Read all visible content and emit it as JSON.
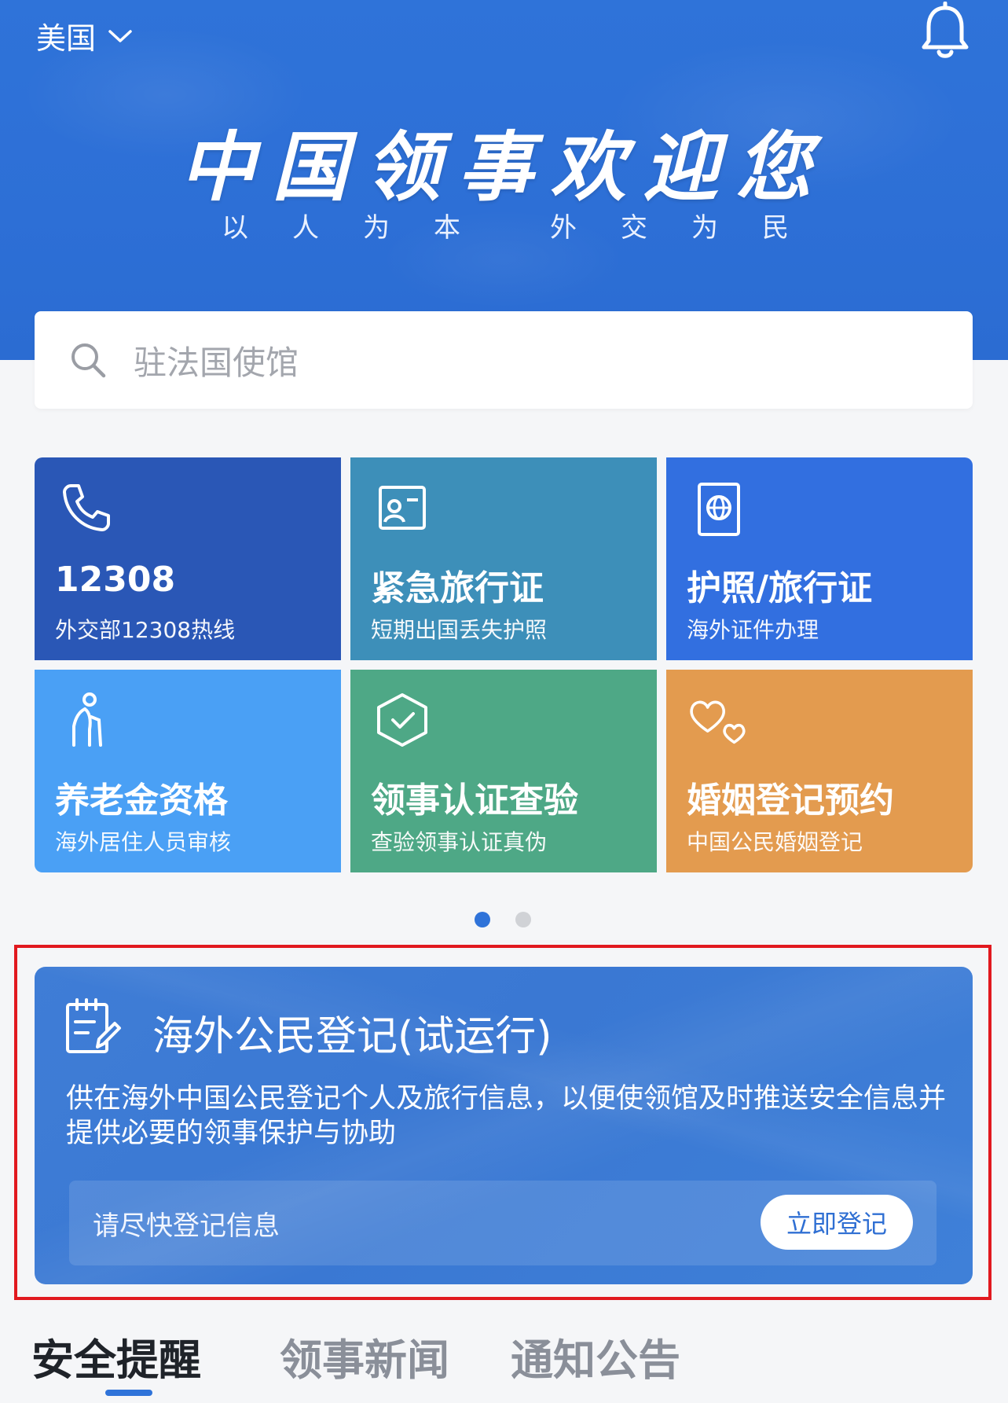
{
  "header": {
    "country": "美国",
    "slogan": "中国领事欢迎您",
    "motto_left": "以人为本",
    "motto_right": "外交为民"
  },
  "search": {
    "placeholder": "驻法国使馆"
  },
  "services": [
    {
      "title": "12308",
      "subtitle": "外交部12308热线",
      "icon": "phone-icon",
      "color": "#2a57b6"
    },
    {
      "title": "紧急旅行证",
      "subtitle": "短期出国丢失护照",
      "icon": "id-card-icon",
      "color": "#3d8fb9"
    },
    {
      "title": "护照/旅行证",
      "subtitle": "海外证件办理",
      "icon": "passport-icon",
      "color": "#326fe0"
    },
    {
      "title": "养老金资格",
      "subtitle": "海外居住人员审核",
      "icon": "elderly-person-icon",
      "color": "#4aa0f5"
    },
    {
      "title": "领事认证查验",
      "subtitle": "查验领事认证真伪",
      "icon": "shield-check-icon",
      "color": "#4ea886"
    },
    {
      "title": "婚姻登记预约",
      "subtitle": "中国公民婚姻登记",
      "icon": "hearts-icon",
      "color": "#e39b4f"
    }
  ],
  "pager": {
    "active_page": 1,
    "total_pages": 2,
    "active_color": "#2f73d9",
    "inactive_color": "#d0d2d6"
  },
  "registration": {
    "title": "海外公民登记(试运行)",
    "description": "供在海外中国公民登记个人及旅行信息，以便使领馆及时推送安全信息并提供必要的领事保护与协助",
    "hint": "请尽快登记信息",
    "button": "立即登记"
  },
  "tabs": [
    {
      "label": "安全提醒",
      "active": true
    },
    {
      "label": "领事新闻",
      "active": false
    },
    {
      "label": "通知公告",
      "active": false
    }
  ]
}
